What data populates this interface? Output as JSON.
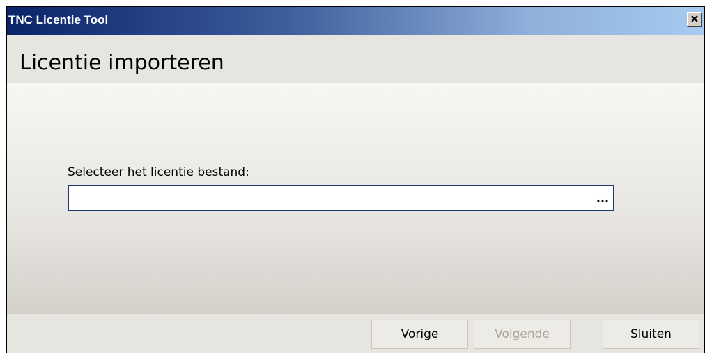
{
  "window": {
    "title": "TNC Licentie Tool",
    "close_symbol": "close-icon"
  },
  "header": {
    "title": "Licentie importeren"
  },
  "content": {
    "file_label": "Selecteer het licentie bestand:",
    "file_value": "",
    "browse_label": "..."
  },
  "footer": {
    "prev_label": "Vorige",
    "next_label": "Volgende",
    "next_disabled": true,
    "close_label": "Sluiten"
  },
  "colors": {
    "titlebar_start": "#0a246a",
    "titlebar_end": "#a6caf0",
    "disabled_text": "#a8a49a"
  }
}
